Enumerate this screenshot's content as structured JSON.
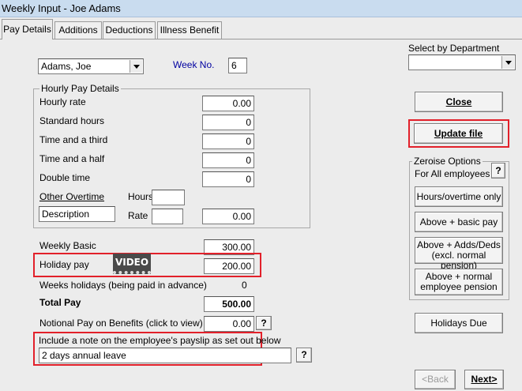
{
  "window": {
    "title": "Weekly Input - Joe Adams"
  },
  "tabs": [
    {
      "label": "Pay Details"
    },
    {
      "label": "Additions"
    },
    {
      "label": "Deductions"
    },
    {
      "label": "Illness Benefit"
    }
  ],
  "employee": {
    "selected": "Adams, Joe",
    "week_label": "Week No.",
    "week_value": "6"
  },
  "hourly": {
    "title": "Hourly Pay Details",
    "rows": [
      {
        "label": "Hourly rate",
        "value": "0.00"
      },
      {
        "label": "Standard hours",
        "value": "0"
      },
      {
        "label": "Time and a third",
        "value": "0"
      },
      {
        "label": "Time and a half",
        "value": "0"
      },
      {
        "label": "Double time",
        "value": "0"
      }
    ],
    "other_overtime_label": "Other Overtime",
    "hours_label": "Hours",
    "hours_value": "",
    "description_value": "Description",
    "rate_label": "Rate",
    "rate_value": "",
    "other_total": "0.00"
  },
  "pay": {
    "weekly_basic_label": "Weekly Basic",
    "weekly_basic_value": "300.00",
    "holiday_pay_label": "Holiday pay",
    "holiday_pay_value": "200.00",
    "video_badge": "VIDEO",
    "weeks_holidays_label": "Weeks holidays (being paid in advance)",
    "weeks_holidays_value": "0",
    "total_pay_label": "Total Pay",
    "total_pay_value": "500.00",
    "notional_label": "Notional Pay on Benefits (click to view)",
    "notional_value": "0.00",
    "help": "?"
  },
  "note": {
    "label": "Include a note on the employee's payslip as set out below",
    "value": "2 days annual leave"
  },
  "department": {
    "label": "Select by Department",
    "selected": ""
  },
  "buttons": {
    "close": "Close",
    "update": "Update file",
    "holidays_due": "Holidays Due",
    "back": "<Back",
    "next": "Next>"
  },
  "zeroise": {
    "title": "Zeroise Options",
    "subtitle": "For All employees",
    "help": "?",
    "opt1": "Hours/overtime only",
    "opt2": "Above + basic pay",
    "opt3_line1": "Above + Adds/Deds",
    "opt3_line2": "(excl. normal pension)",
    "opt4_line1": "Above + normal",
    "opt4_line2": "employee pension"
  },
  "colors": {
    "highlight": "#e2202a",
    "accent_text": "#0000a0"
  }
}
